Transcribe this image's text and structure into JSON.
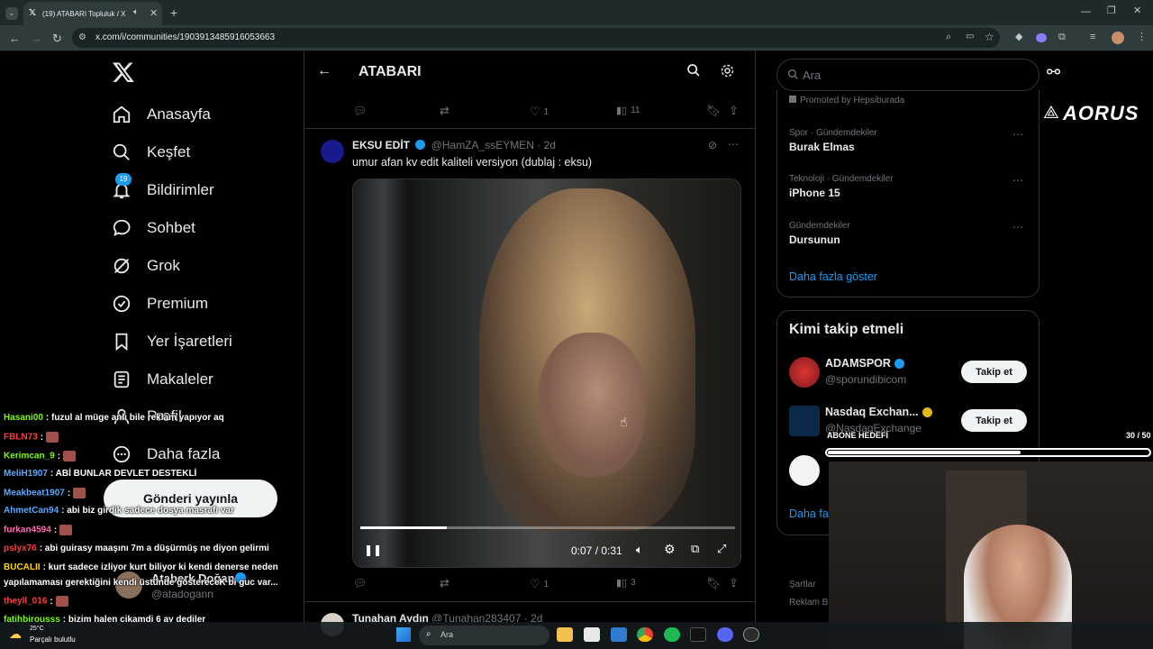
{
  "browser": {
    "tab_title": "(19) ATABARI Topluluk / X",
    "url": "x.com/i/communities/1903913485916053663"
  },
  "nav": {
    "items": [
      {
        "label": "Anasayfa"
      },
      {
        "label": "Keşfet"
      },
      {
        "label": "Bildirimler",
        "badge": "19"
      },
      {
        "label": "Sohbet"
      },
      {
        "label": "Grok"
      },
      {
        "label": "Premium"
      },
      {
        "label": "Yer İşaretleri"
      },
      {
        "label": "Makaleler"
      },
      {
        "label": "Profil"
      },
      {
        "label": "Daha fazla"
      }
    ],
    "post_button": "Gönderi yayınla",
    "account": {
      "name": "Ataberk Doğan",
      "handle": "@atadogann"
    }
  },
  "header": {
    "title": "ATABARI"
  },
  "prev_post": {
    "likes": "1",
    "views": "11"
  },
  "post": {
    "author": "EKSU EDİT",
    "handle": "@HamZA_ssEYMEN",
    "time": "· 2d",
    "text": "umur afan kv edit kaliteli versiyon (dublaj : eksu)",
    "video_time": "0:07 / 0:31",
    "video_progress": 0.23,
    "likes": "1",
    "views": "3"
  },
  "next_post": {
    "author": "Tunahan Aydın",
    "handle": "@Tunahan283407",
    "time": "· 2d"
  },
  "sidebar": {
    "search_placeholder": "Ara",
    "promoted": "Promoted by Hepsiburada",
    "trends": [
      {
        "category": "Spor · Gündemdekiler",
        "name": "Burak Elmas"
      },
      {
        "category": "Teknoloji · Gündemdekiler",
        "name": "iPhone 15"
      },
      {
        "category": "Gündemdekiler",
        "name": "Dursunun"
      }
    ],
    "show_more": "Daha fazla göster",
    "who_to_follow_title": "Kimi takip etmeli",
    "suggestions": [
      {
        "name": "ADAMSPOR",
        "handle": "@sporundibicom",
        "button": "Takip et"
      },
      {
        "name": "Nasdaq Exchan...",
        "handle": "@NasdaqExchange",
        "button": "Takip et"
      }
    ],
    "show_more_2": "Daha fa",
    "footer1": "Şartlar",
    "footer2": "Reklam Bil"
  },
  "overlay": {
    "brand": "AORUS",
    "goal_label": "ABONE HEDEFİ",
    "goal_count": "30 / 50",
    "goal_progress": 0.6
  },
  "chat": [
    {
      "user": "Hasani00",
      "color": "#7CFC00",
      "msg": ": fuzul al müge anlı bile reklam yapıyor aq"
    },
    {
      "user": "FBLN73",
      "color": "#ff3b3b",
      "msg": ":"
    },
    {
      "user": "Kerimcan_9",
      "color": "#7CFC00",
      "msg": ":"
    },
    {
      "user": "MeliH1907",
      "color": "#5aa9ff",
      "msg": ": ABİ BUNLAR DEVLET DESTEKLİ"
    },
    {
      "user": "Meakbeat1907",
      "color": "#5aa9ff",
      "msg": ":"
    },
    {
      "user": "AhmetCan94",
      "color": "#5aa9ff",
      "msg": ": abi biz girdik sadece dosya masrafı var"
    },
    {
      "user": "furkan4594",
      "color": "#ff69b4",
      "msg": ":"
    },
    {
      "user": "pslyx76",
      "color": "#ff3b3b",
      "msg": ": abi guirasy maaşını 7m a düşürmüş ne diyon gelirmi"
    },
    {
      "user": "BUCALII",
      "color": "#ffd700",
      "msg": ": kurt sadece izliyor kurt biliyor ki kendi denerse neden"
    },
    {
      "user": "",
      "color": "#fff",
      "msg": "yapılamaması gerektiğini kendi üstünde göstereceK bi guc var..."
    },
    {
      "user": "theyll_016",
      "color": "#ff3b3b",
      "msg": ":"
    },
    {
      "user": "fatihbirousss",
      "color": "#7CFC00",
      "msg": ": bizim halen cikamdi 6 ay dediler"
    }
  ],
  "taskbar": {
    "weather_temp": "25°C",
    "weather_desc": "Parçalı bulutlu",
    "search_label": "Ara"
  }
}
